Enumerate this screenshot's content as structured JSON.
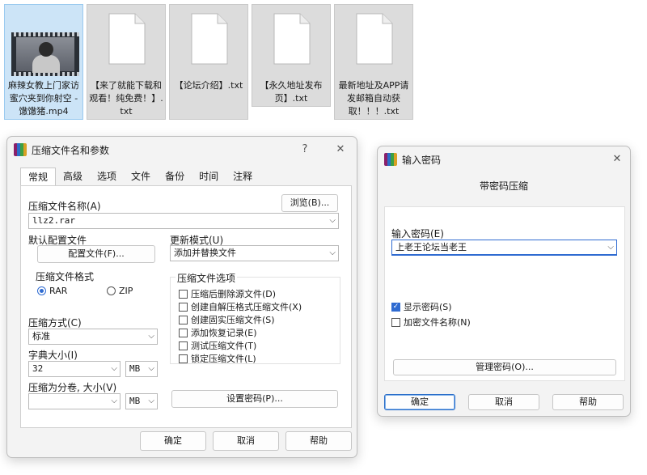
{
  "files": [
    {
      "name": "麻辣女教上门家访蜜穴夹到你射空 - 馓馓猪.mp4",
      "type": "video"
    },
    {
      "name": "【来了就能下载和观看！纯免费！】.txt",
      "type": "text"
    },
    {
      "name": "【论坛介绍】.txt",
      "type": "text"
    },
    {
      "name": "【永久地址发布页】.txt",
      "type": "text"
    },
    {
      "name": "最新地址及APP请发邮箱自动获取！！！.txt",
      "type": "text"
    }
  ],
  "archive_dialog": {
    "title": "压缩文件名和参数",
    "help_glyph": "?",
    "close_glyph": "✕",
    "tabs": [
      "常规",
      "高级",
      "选项",
      "文件",
      "备份",
      "时间",
      "注释"
    ],
    "archive_name_label": "压缩文件名称(A)",
    "browse_label": "浏览(B)...",
    "archive_name_value": "llz2.rar",
    "default_profile_label": "默认配置文件",
    "profiles_button": "配置文件(F)...",
    "update_mode_label": "更新模式(U)",
    "update_mode_value": "添加并替换文件",
    "format_group_label": "压缩文件格式",
    "format_rar": "RAR",
    "format_zip": "ZIP",
    "format_selected": "RAR",
    "options_group_label": "压缩文件选项",
    "options": [
      {
        "label": "压缩后删除源文件(D)",
        "checked": false
      },
      {
        "label": "创建自解压格式压缩文件(X)",
        "checked": false
      },
      {
        "label": "创建固实压缩文件(S)",
        "checked": false
      },
      {
        "label": "添加恢复记录(E)",
        "checked": false
      },
      {
        "label": "测试压缩文件(T)",
        "checked": false
      },
      {
        "label": "锁定压缩文件(L)",
        "checked": false
      }
    ],
    "method_label": "压缩方式(C)",
    "method_value": "标准",
    "dict_label": "字典大小(I)",
    "dict_value": "32",
    "dict_unit": "MB",
    "split_label": "压缩为分卷, 大小(V)",
    "split_value": "",
    "split_unit": "MB",
    "set_password_button": "设置密码(P)...",
    "ok": "确定",
    "cancel": "取消",
    "help": "帮助"
  },
  "password_dialog": {
    "title": "输入密码",
    "close_glyph": "✕",
    "subtitle": "带密码压缩",
    "password_label": "输入密码(E)",
    "password_value": "上老王论坛当老王",
    "show_password_label": "显示密码(S)",
    "show_password_checked": true,
    "encrypt_names_label": "加密文件名称(N)",
    "encrypt_names_checked": false,
    "manage_button": "管理密码(O)...",
    "ok": "确定",
    "cancel": "取消",
    "help": "帮助"
  },
  "colors": {
    "accent": "#2f6bd1",
    "selection": "#cce4f7"
  }
}
